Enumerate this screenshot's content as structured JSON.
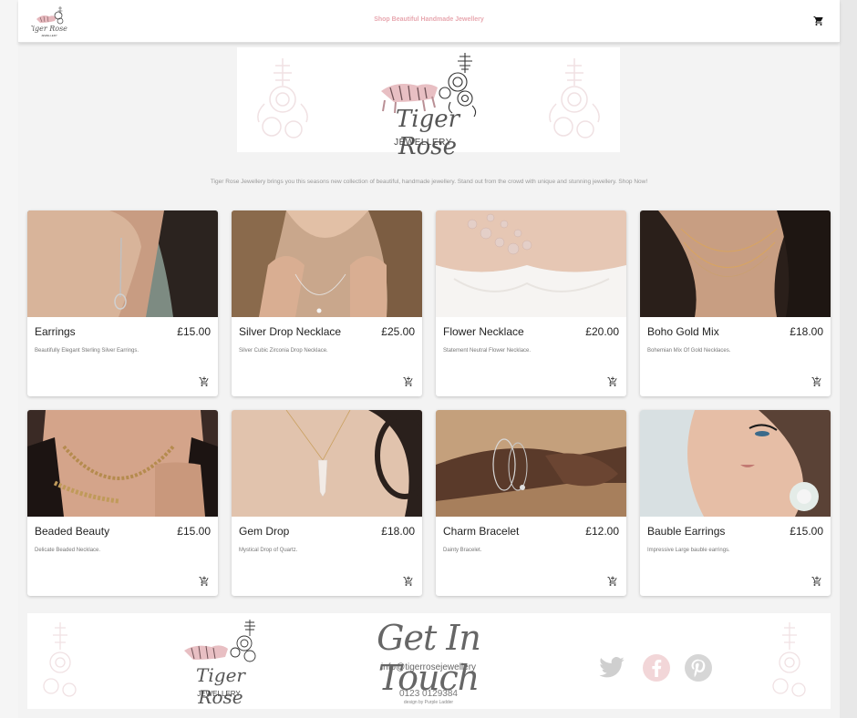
{
  "header": {
    "tagline": "Shop Beautiful Handmade Jewellery",
    "cart_icon": "cart-icon",
    "logo_icon": "tiger-rose-logo-icon"
  },
  "banner": {
    "brand_name": "Tiger Rose",
    "brand_sub": "JEWELLERY"
  },
  "intro": "Tiger Rose Jewellery brings you this seasons new collection of beautiful, handmade jewellery. Stand out from the crowd with unique and stunning jewellery. Shop Now!",
  "products": [
    {
      "name": "Earrings",
      "price": "£15.00",
      "description": "Beautifully Elegant Sterling Silver Earrings.",
      "image_icon": "earrings-photo"
    },
    {
      "name": "Silver Drop Necklace",
      "price": "£25.00",
      "description": "Silver Cubic Zirconia Drop Necklace.",
      "image_icon": "silver-necklace-photo"
    },
    {
      "name": "Flower Necklace",
      "price": "£20.00",
      "description": "Statement Neutral Flower Necklace.",
      "image_icon": "flower-necklace-photo"
    },
    {
      "name": "Boho Gold Mix",
      "price": "£18.00",
      "description": "Bohemian Mix Of Gold Necklaces.",
      "image_icon": "gold-necklaces-photo"
    },
    {
      "name": "Beaded Beauty",
      "price": "£15.00",
      "description": "Delicate Beaded Necklace.",
      "image_icon": "beaded-necklace-photo"
    },
    {
      "name": "Gem Drop",
      "price": "£18.00",
      "description": "Mystical Drop of Quartz.",
      "image_icon": "quartz-pendant-photo"
    },
    {
      "name": "Charm Bracelet",
      "price": "£12.00",
      "description": "Dainty Bracelet.",
      "image_icon": "charm-bracelet-photo"
    },
    {
      "name": "Bauble Earrings",
      "price": "£15.00",
      "description": "Impressive Large bauble earrings.",
      "image_icon": "bauble-earrings-photo"
    }
  ],
  "footer": {
    "brand_name": "Tiger Rose",
    "brand_sub": "JEWELLERY",
    "heading": "Get In Touch",
    "email": "info@tigerrosejewellery",
    "phone": "0123 0129384",
    "credit": "design by Purple Ladder",
    "social": [
      "twitter-icon",
      "facebook-icon",
      "pinterest-icon"
    ]
  },
  "colors": {
    "accent_pink": "#e8a8b0",
    "social_grey": "#cfcfcf",
    "facebook_pink": "#f2d6d8"
  }
}
